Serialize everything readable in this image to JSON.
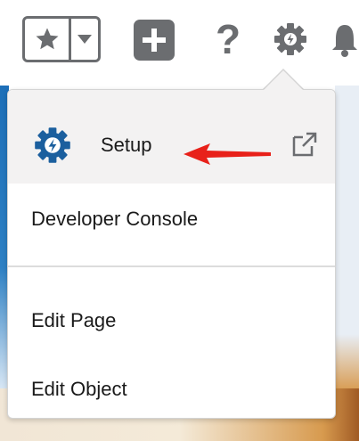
{
  "header": {
    "favorites_icon": "star-icon",
    "favorites_menu_icon": "caret-down-icon",
    "add_icon": "plus-icon",
    "help_label": "?",
    "setup_gear_icon": "gear-icon",
    "notifications_icon": "bell-icon"
  },
  "menu": {
    "items": [
      {
        "label": "Setup",
        "icon": "setup-gear-icon",
        "external_icon": "open-in-new-window-icon"
      },
      {
        "label": "Developer Console"
      },
      {
        "label": "Edit Page"
      },
      {
        "label": "Edit Object"
      }
    ]
  },
  "colors": {
    "icon_gray": "#6b6d70",
    "setup_blue": "#1b5f9e",
    "highlight_bg": "#f3f2f2",
    "arrow_red": "#e8211a"
  }
}
